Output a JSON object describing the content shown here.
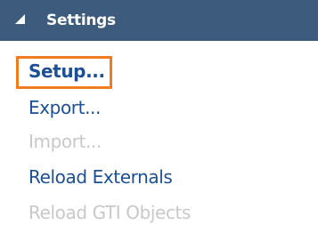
{
  "panel": {
    "title": "Settings",
    "items": [
      {
        "label": "Setup...",
        "state": "selected"
      },
      {
        "label": "Export...",
        "state": "enabled"
      },
      {
        "label": "Import...",
        "state": "disabled"
      },
      {
        "label": "Reload Externals",
        "state": "enabled"
      },
      {
        "label": "Reload GTI Objects",
        "state": "disabled"
      }
    ]
  },
  "colors": {
    "header_bg": "#3c5b7d",
    "link": "#1c4f96",
    "disabled": "#c8c8c8",
    "focus": "#f07c1e"
  },
  "icons": {
    "header_toggle": "collapse-triangle-icon"
  }
}
